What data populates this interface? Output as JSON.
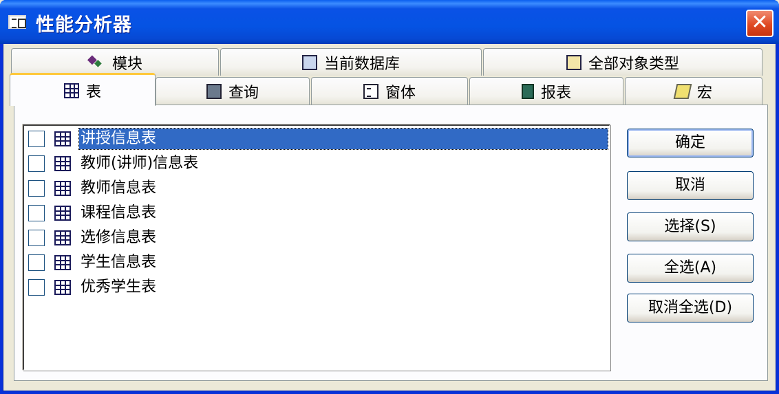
{
  "window": {
    "title": "性能分析器",
    "close_symbol": "✕"
  },
  "tabs_top": [
    {
      "label": "模块",
      "icon": "module-icon"
    },
    {
      "label": "当前数据库",
      "icon": "database-icon"
    },
    {
      "label": "全部对象类型",
      "icon": "all-objects-icon"
    }
  ],
  "tabs_bottom": [
    {
      "label": "表",
      "icon": "table-icon",
      "active": true
    },
    {
      "label": "查询",
      "icon": "query-icon"
    },
    {
      "label": "窗体",
      "icon": "form-icon"
    },
    {
      "label": "报表",
      "icon": "report-icon"
    },
    {
      "label": "宏",
      "icon": "macro-icon"
    }
  ],
  "list": {
    "items": [
      {
        "label": "讲授信息表",
        "checked": false,
        "selected": true
      },
      {
        "label": "教师(讲师)信息表",
        "checked": false
      },
      {
        "label": "教师信息表",
        "checked": false
      },
      {
        "label": "课程信息表",
        "checked": false
      },
      {
        "label": "选修信息表",
        "checked": false
      },
      {
        "label": "学生信息表",
        "checked": false
      },
      {
        "label": "优秀学生表",
        "checked": false
      }
    ]
  },
  "buttons": {
    "ok": "确定",
    "cancel": "取消",
    "select": "选择(S)",
    "select_all": "全选(A)",
    "deselect_all": "取消全选(D)"
  },
  "colors": {
    "titlebar": "#0553e3",
    "selection": "#316ac5",
    "tab_highlight": "#ffc83c"
  }
}
